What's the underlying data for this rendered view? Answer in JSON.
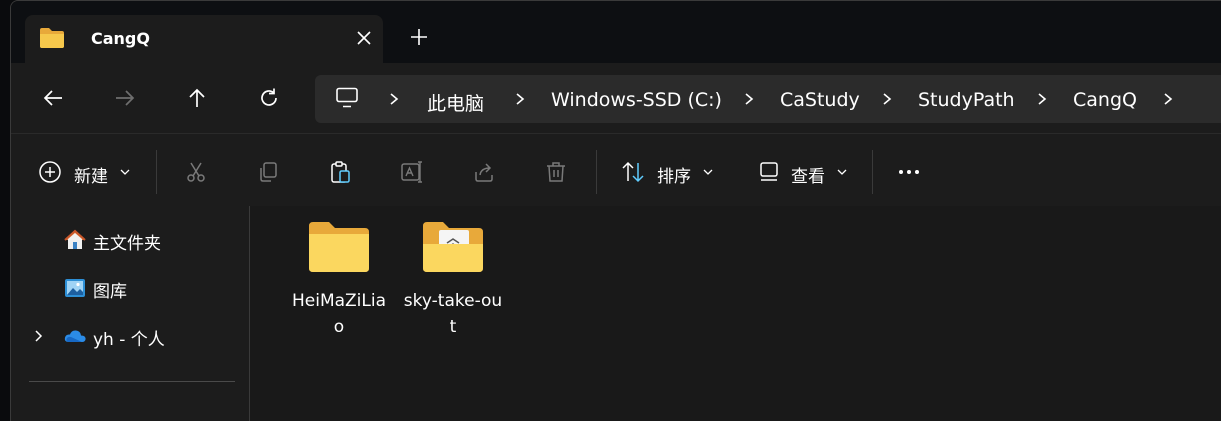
{
  "tab": {
    "title": "CangQ"
  },
  "breadcrumb": [
    "此电脑",
    "Windows-SSD (C:)",
    "CaStudy",
    "StudyPath",
    "CangQ"
  ],
  "toolbar": {
    "new_label": "新建",
    "sort_label": "排序",
    "view_label": "查看"
  },
  "sidebar": {
    "items": [
      {
        "label": "主文件夹",
        "icon": "home-icon"
      },
      {
        "label": "图库",
        "icon": "gallery-icon"
      },
      {
        "label": "yh - 个人",
        "icon": "onedrive-cloud-icon"
      }
    ]
  },
  "files": [
    {
      "name": "HeiMaZiLiao",
      "icon": "folder-icon"
    },
    {
      "name": "sky-take-out",
      "icon": "folder-with-content-icon"
    }
  ],
  "colors": {
    "folder": "#f4c542",
    "accent": "#60cdff"
  }
}
